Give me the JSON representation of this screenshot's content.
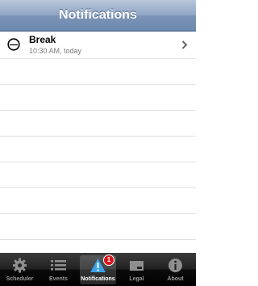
{
  "navbar": {
    "title": "Notifications"
  },
  "list": {
    "items": [
      {
        "title": "Break",
        "subtitle": "10:30 AM, today",
        "icon": "clock-icon"
      }
    ]
  },
  "tabbar": {
    "tabs": [
      {
        "label": "Scheduler",
        "icon": "gear-icon",
        "selected": false
      },
      {
        "label": "Events",
        "icon": "list-icon",
        "selected": false
      },
      {
        "label": "Notifications",
        "icon": "warning-icon",
        "selected": true,
        "badge": "1"
      },
      {
        "label": "Legal",
        "icon": "folder-icon",
        "selected": false
      },
      {
        "label": "About",
        "icon": "info-icon",
        "selected": false
      }
    ]
  },
  "colors": {
    "navbar_top": "#b9c7dc",
    "navbar_bottom": "#6e89af",
    "badge": "#d8161b",
    "tabbar": "#000000"
  }
}
